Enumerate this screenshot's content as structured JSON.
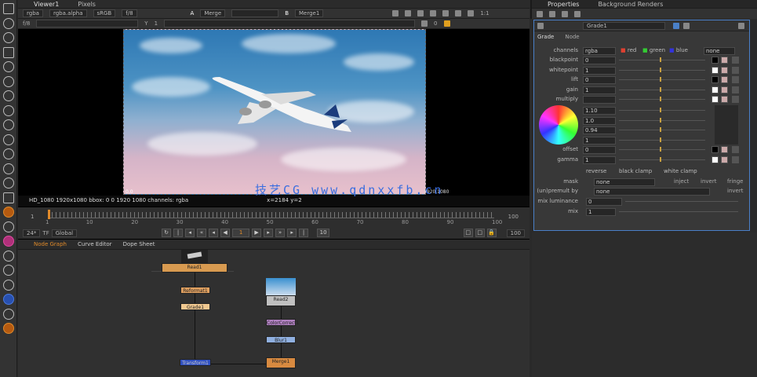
{
  "viewer": {
    "tabs": [
      "Viewer1",
      "Pixels"
    ],
    "toolbar1": {
      "channels": "rgba",
      "layer": "rgba.alpha",
      "colorspace": "sRGB",
      "gain": "f/8",
      "input_a": "A",
      "node_a": "Merge",
      "input_b": "B",
      "node_b": "Merge1",
      "zoom": "1:1"
    },
    "toolbar2": {
      "fstop": "f/8",
      "frame": "1",
      "gamma": "Y",
      "gamma_val": "1",
      "proxy": "0"
    },
    "info_left": "HD_1080 1920x1080  bbox: 0 0 1920 1080  channels: rgba",
    "info_mid": "x=2184 y=2",
    "corner_bl": "0,0",
    "corner_br": "1920,1080"
  },
  "watermark": "技艺CG  www.qdnxxfb.cn",
  "timeline": {
    "start": "1",
    "end": "100",
    "ticks": [
      "1",
      "10",
      "20",
      "30",
      "40",
      "50",
      "60",
      "70",
      "80",
      "90",
      "100"
    ],
    "current_frame": 1,
    "fps": "24*",
    "mode": "TF",
    "range": "Global",
    "end_field": "100",
    "step": "10"
  },
  "nodegraph": {
    "tabs": [
      "Node Graph",
      "Curve Editor",
      "Dope Sheet"
    ],
    "nodes": [
      {
        "label": "Read1",
        "color": "#d89a50"
      },
      {
        "label": "Reformat1",
        "color": "#e0a060"
      },
      {
        "label": "Grade1",
        "color": "#f0c890"
      },
      {
        "label": "Transform1",
        "color": "#3050c0"
      },
      {
        "label": "Read2",
        "color": "#c0c0c0"
      },
      {
        "label": "ColorCorrect1",
        "color": "#b080c0"
      },
      {
        "label": "Blur1",
        "color": "#90b0e0"
      },
      {
        "label": "Merge1",
        "color": "#d88a40"
      }
    ]
  },
  "properties": {
    "tabs": [
      "Properties",
      "Background Renders"
    ],
    "node_name": "Grade1",
    "panel_tabs": [
      "Grade",
      "Node"
    ],
    "channels": {
      "label": "channels",
      "value": "rgba",
      "r": "red",
      "g": "green",
      "b": "blue",
      "extra": "none"
    },
    "rows": [
      {
        "label": "blackpoint",
        "value": "0"
      },
      {
        "label": "whitepoint",
        "value": "1"
      },
      {
        "label": "lift",
        "value": "0"
      },
      {
        "label": "gain",
        "value": "1"
      },
      {
        "label": "multiply",
        "value": ""
      }
    ],
    "wheel_rows": [
      {
        "value": "1.10"
      },
      {
        "value": "1.0"
      },
      {
        "value": "0.94"
      },
      {
        "value": "1"
      }
    ],
    "rows2": [
      {
        "label": "offset",
        "value": "0"
      },
      {
        "label": "gamma",
        "value": "1"
      }
    ],
    "checks": [
      "reverse",
      "black clamp",
      "white clamp"
    ],
    "mask": {
      "label": "mask",
      "value": "none",
      "inject": "inject",
      "invert": "invert",
      "fringe": "fringe"
    },
    "unpremult": {
      "label": "(un)premult by",
      "value": "none",
      "invert": "invert"
    },
    "mix_luminance": {
      "label": "mix luminance",
      "value": "0"
    },
    "mix": {
      "label": "mix",
      "value": "1"
    }
  }
}
